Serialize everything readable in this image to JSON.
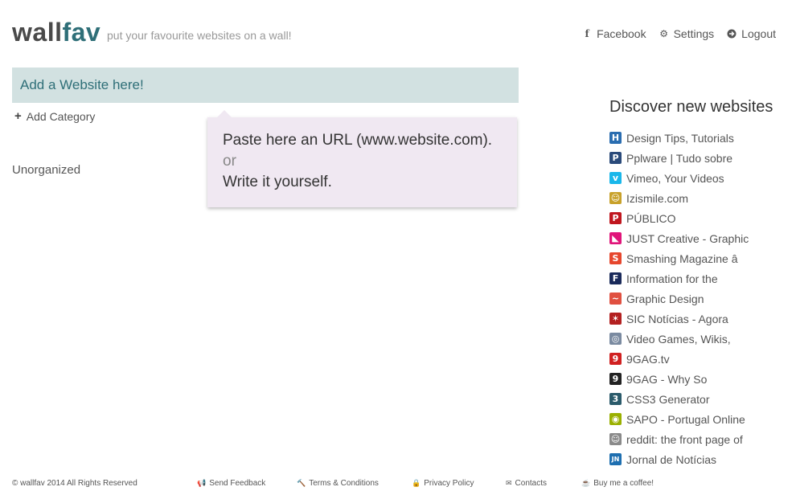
{
  "header": {
    "logo_part1": "wall",
    "logo_part2": "fav",
    "tagline": "put your favourite websites on a wall!",
    "nav": {
      "facebook": "Facebook",
      "settings": "Settings",
      "logout": "Logout"
    }
  },
  "main": {
    "add_website_placeholder": "Add a Website here!",
    "add_category": "Add Category",
    "category_name": "Unorganized",
    "tooltip": {
      "line1": "Paste here an URL (www.website.com).",
      "line2": "or",
      "line3": "Write it yourself."
    }
  },
  "discover": {
    "title": "Discover new websites",
    "sites": [
      {
        "label": "Design Tips, Tutorials",
        "icon": "H",
        "color": "#2a6db0"
      },
      {
        "label": "Pplware | Tudo sobre",
        "icon": "P",
        "color": "#2a4a7a"
      },
      {
        "label": "Vimeo, Your Videos",
        "icon": "v",
        "color": "#1ab7ea"
      },
      {
        "label": "Izismile.com",
        "icon": "☺",
        "color": "#c8a12a"
      },
      {
        "label": "PÚBLICO",
        "icon": "P",
        "color": "#c0161e"
      },
      {
        "label": "JUST Creative - Graphic",
        "icon": "◣",
        "color": "#e0157a"
      },
      {
        "label": "Smashing Magazine â",
        "icon": "S",
        "color": "#e6462d"
      },
      {
        "label": "Information for the",
        "icon": "F",
        "color": "#1a2a5a"
      },
      {
        "label": "Graphic Design",
        "icon": "~",
        "color": "#e05040"
      },
      {
        "label": "SIC Notícias - Agora",
        "icon": "✶",
        "color": "#b32020"
      },
      {
        "label": "Video Games, Wikis,",
        "icon": "◎",
        "color": "#7a8aa0"
      },
      {
        "label": "9GAG.tv",
        "icon": "9",
        "color": "#d02020"
      },
      {
        "label": "9GAG - Why So",
        "icon": "9",
        "color": "#222222"
      },
      {
        "label": "CSS3 Generator",
        "icon": "3",
        "color": "#2a5a6a"
      },
      {
        "label": "SAPO - Portugal Online",
        "icon": "◉",
        "color": "#9ab000"
      },
      {
        "label": "reddit: the front page of",
        "icon": "☺",
        "color": "#8a8a8a"
      },
      {
        "label": "Jornal de Notícias",
        "icon": "JN",
        "color": "#1e6fb0"
      }
    ]
  },
  "footer": {
    "copyright": "© wallfav 2014 All Rights Reserved",
    "send_feedback": "Send Feedback",
    "terms": "Terms & Conditions",
    "privacy": "Privacy Policy",
    "contacts": "Contacts",
    "coffee": "Buy me a coffee!"
  }
}
